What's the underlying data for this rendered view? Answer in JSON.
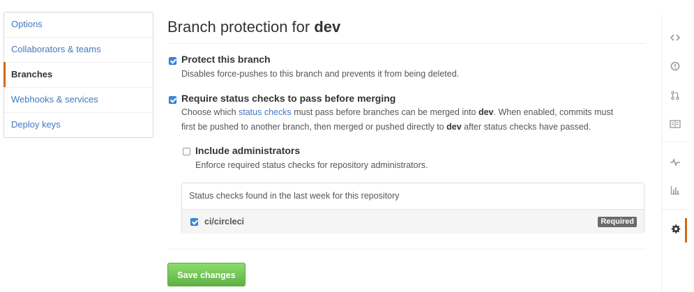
{
  "sidebar": {
    "items": [
      {
        "label": "Options"
      },
      {
        "label": "Collaborators & teams"
      },
      {
        "label": "Branches"
      },
      {
        "label": "Webhooks & services"
      },
      {
        "label": "Deploy keys"
      }
    ]
  },
  "header": {
    "title_prefix": "Branch protection for",
    "branch": "dev"
  },
  "protect": {
    "label": "Protect this branch",
    "checked": true,
    "note": "Disables force-pushes to this branch and prevents it from being deleted."
  },
  "status_checks": {
    "label": "Require status checks to pass before merging",
    "checked": true,
    "note_1": "Choose which",
    "link": "status checks",
    "note_2": "must pass before branches can be merged into",
    "branch": "dev",
    "note_3": ". When enabled, commits must",
    "note_4": "first be pushed to another branch, then merged or pushed directly to",
    "branch_2": "dev",
    "note_5": "after status checks have passed."
  },
  "include_admins": {
    "label": "Include administrators",
    "checked": false,
    "note": "Enforce required status checks for repository administrators."
  },
  "checks_box": {
    "header": "Status checks found in the last week for this repository",
    "items": [
      {
        "name": "ci/circleci",
        "checked": true,
        "badge": "Required"
      }
    ]
  },
  "actions": {
    "save_label": "Save changes"
  },
  "rail": {
    "icons": [
      "code-icon",
      "issues-icon",
      "pull-request-icon",
      "wiki-icon",
      "pulse-icon",
      "graphs-icon",
      "settings-icon"
    ]
  },
  "colors": {
    "link": "#4078c0",
    "accent": "#d26911",
    "checkbox": "#3d8be2",
    "save_button": "#60b044",
    "badge": "#6a6a6a"
  }
}
